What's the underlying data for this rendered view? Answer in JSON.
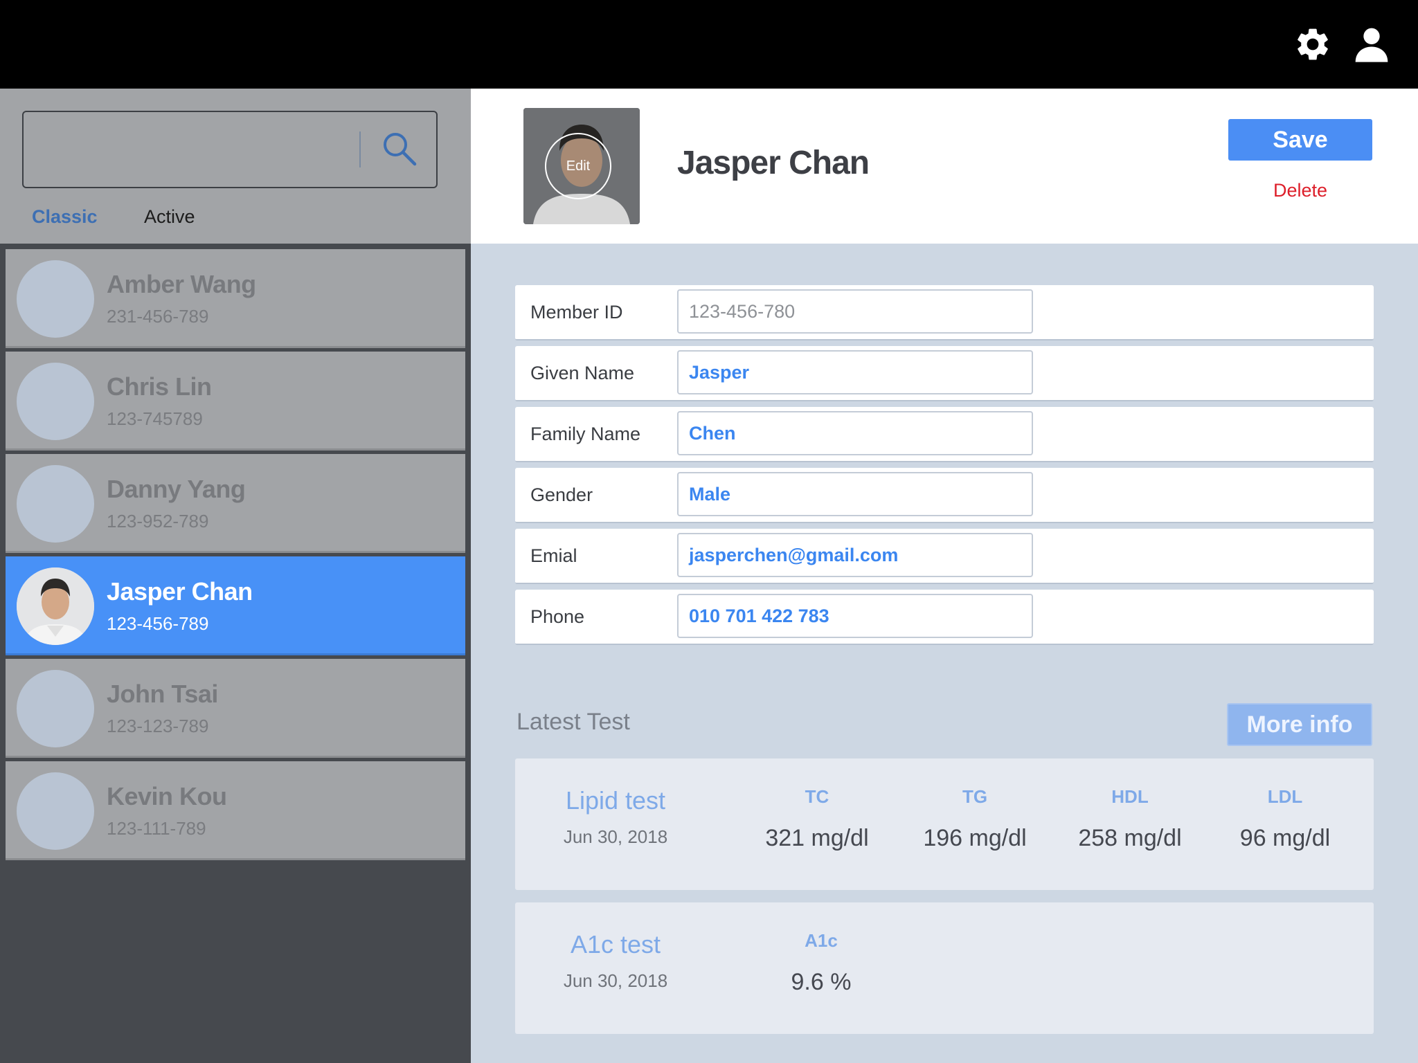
{
  "topbar": {
    "icons": [
      "gear-icon",
      "user-icon"
    ],
    "background": "#000000"
  },
  "sidebar": {
    "search": {
      "value": "",
      "placeholder": ""
    },
    "tabs": [
      {
        "label": "Classic",
        "selected": true
      },
      {
        "label": "Active",
        "selected": false
      }
    ],
    "members": [
      {
        "name": "Amber Wang",
        "phone": "231-456-789",
        "selected": false
      },
      {
        "name": "Chris Lin",
        "phone": "123-745789",
        "selected": false
      },
      {
        "name": "Danny Yang",
        "phone": "123-952-789",
        "selected": false
      },
      {
        "name": "Jasper Chan",
        "phone": "123-456-789",
        "selected": true
      },
      {
        "name": "John Tsai",
        "phone": "123-123-789",
        "selected": false
      },
      {
        "name": "Kevin Kou",
        "phone": "123-111-789",
        "selected": false
      }
    ]
  },
  "profile": {
    "photo_edit_label": "Edit",
    "name": "Jasper Chan",
    "save_label": "Save",
    "delete_label": "Delete"
  },
  "form": {
    "fields": [
      {
        "label": "Member ID",
        "value": "123-456-780",
        "readonly": true
      },
      {
        "label": "Given Name",
        "value": "Jasper",
        "readonly": false
      },
      {
        "label": "Family Name",
        "value": "Chen",
        "readonly": false
      },
      {
        "label": "Gender",
        "value": "Male",
        "readonly": false
      },
      {
        "label": "Emial",
        "value": "jasperchen@gmail.com",
        "readonly": false
      },
      {
        "label": "Phone",
        "value": "010 701 422 783",
        "readonly": false
      }
    ]
  },
  "latest_test": {
    "title": "Latest Test",
    "more_info_label": "More info",
    "tests": [
      {
        "name": "Lipid test",
        "date": "Jun 30, 2018",
        "metrics": [
          {
            "label": "TC",
            "value": "321 mg/dl"
          },
          {
            "label": "TG",
            "value": "196 mg/dl"
          },
          {
            "label": "HDL",
            "value": "258 mg/dl"
          },
          {
            "label": "LDL",
            "value": "96 mg/dl"
          }
        ]
      },
      {
        "name": "A1c test",
        "date": "Jun 30, 2018",
        "metrics": [
          {
            "label": "A1c",
            "value": "9.6 %"
          }
        ]
      }
    ]
  },
  "colors": {
    "accent": "#4891f7",
    "delete": "#dd1f2a",
    "field_text": "#3b86f0"
  }
}
